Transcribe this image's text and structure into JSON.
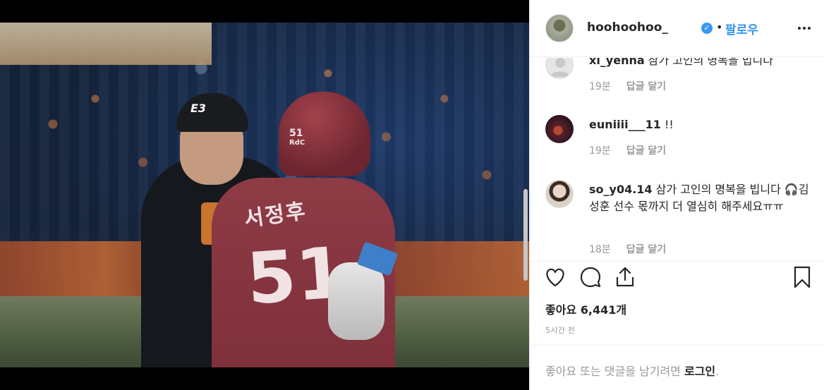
{
  "post": {
    "username": "hoohoohoo_",
    "verified_icon": "verified-badge-icon",
    "separator": "•",
    "follow_label": "팔로우",
    "more_icon": "more-horizontal-icon"
  },
  "photo": {
    "cap_logo": "E3",
    "batter_name": "서정후",
    "batter_number": "51",
    "helmet_number": "51",
    "helmet_text": "RdC"
  },
  "comments": [
    {
      "username": "xi_yenna",
      "text": "삼가 고인의 명복을 빕니다",
      "time": "19분",
      "reply_label": "답글 달기"
    },
    {
      "username": "euniiii___11",
      "text": "!!",
      "time": "19분",
      "reply_label": "답글 달기"
    },
    {
      "username": "so_y04.14",
      "text": "삼가 고인의 명복을 빕니다 🎧김성훈 선수 몫까지 더 열심히 해주세요ㅠㅠ",
      "time": "18분",
      "reply_label": "답글 달기"
    }
  ],
  "actions": {
    "like_icon": "heart-icon",
    "comment_icon": "comment-icon",
    "share_icon": "share-icon",
    "save_icon": "bookmark-icon"
  },
  "likes_text": "좋아요 6,441개",
  "timestamp": "5시간 전",
  "login_prompt": {
    "prefix": "좋아요 또는 댓글을 남기려면 ",
    "link": "로그인",
    "suffix": "."
  },
  "colors": {
    "accent": "#3897f0",
    "text": "#262626",
    "muted": "#999999",
    "border": "#efefef"
  }
}
